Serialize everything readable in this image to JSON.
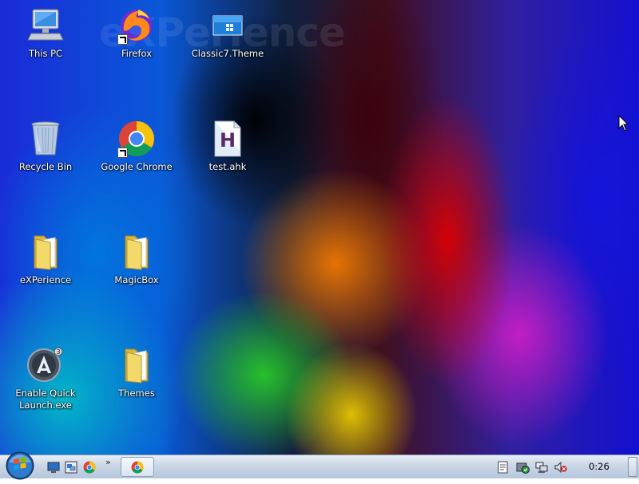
{
  "desktop": {
    "watermark": "eXPerience",
    "icons": [
      {
        "label": "This PC",
        "icon": "computer-icon"
      },
      {
        "label": "Firefox",
        "icon": "firefox-icon"
      },
      {
        "label": "Classic7.Theme",
        "icon": "theme-file-icon"
      },
      {
        "label": "Recycle Bin",
        "icon": "recycle-bin-icon"
      },
      {
        "label": "Google Chrome",
        "icon": "chrome-icon"
      },
      {
        "label": "test.ahk",
        "icon": "autohotkey-script-icon"
      },
      {
        "label": "eXPerience",
        "icon": "folder-icon"
      },
      {
        "label": "MagicBox",
        "icon": "folder-icon"
      },
      {
        "label": "Enable Quick\nLaunch.exe",
        "icon": "quick-launch-exe-icon"
      },
      {
        "label": "Themes",
        "icon": "folder-icon"
      }
    ]
  },
  "taskbar": {
    "start": "start-orb-icon",
    "quick_launch": [
      "show-desktop-icon",
      "switch-windows-icon",
      "chrome-icon"
    ],
    "overflow": "»",
    "tasks": [
      {
        "icon": "chrome-icon"
      }
    ],
    "tray": [
      "notes-icon",
      "security-check-icon",
      "network-icon",
      "volume-muted-icon"
    ],
    "clock": "0:26"
  },
  "colors": {
    "taskbar_top": "#e8eef6",
    "taskbar_bottom": "#b6c7dc",
    "folder": "#f3d86a"
  }
}
